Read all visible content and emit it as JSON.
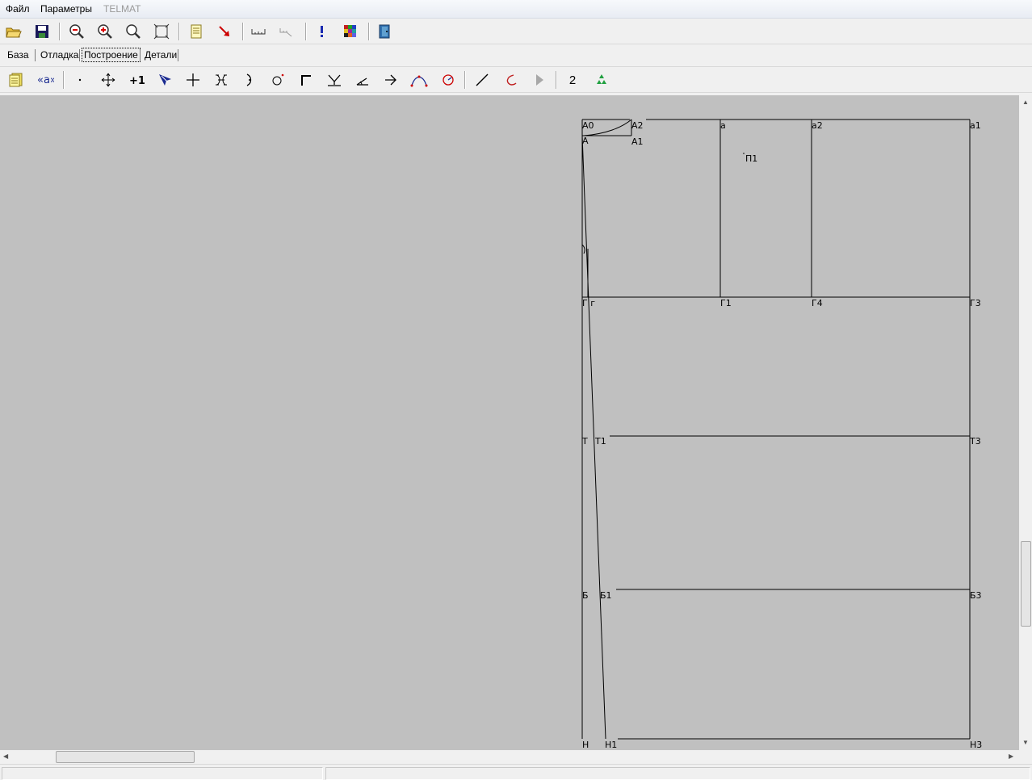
{
  "menu": {
    "file": "Файл",
    "params": "Параметры",
    "telmat": "TELMAT"
  },
  "tabs": {
    "base": "База",
    "debug": "Отладка",
    "build": "Построение",
    "details": "Детали"
  },
  "toolbar2": {
    "number": "2"
  },
  "colors": {
    "canvas": "#c0c0c0",
    "line": "#000000"
  },
  "points": {
    "A0": "А0",
    "A2": "А2",
    "A": "А",
    "A1": "А1",
    "a": "а",
    "a2": "а2",
    "a1": "а1",
    "P1": "П1",
    "Gg": "Г г",
    "G1": "Г1",
    "G4": "Г4",
    "G3": "Г3",
    "T": "Т",
    "T1": "Т1",
    "T3": "Т3",
    "B": "Б",
    "B1": "Б1",
    "B3": "Б3",
    "H": "Н",
    "H1": "Н1",
    "H3": "Н3"
  }
}
